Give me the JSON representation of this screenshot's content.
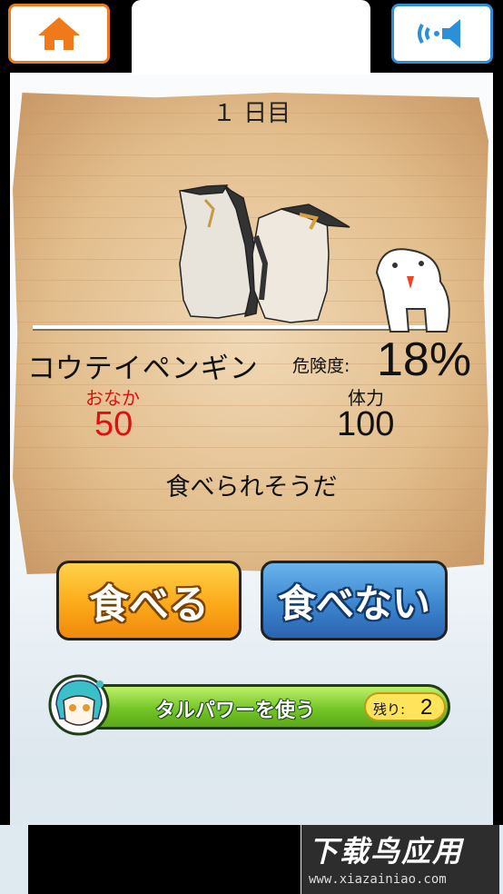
{
  "header": {
    "home_icon": "home-icon",
    "sound_icon": "speaker-icon",
    "accent_home": "#f07a1a",
    "accent_sound": "#2b8fd9"
  },
  "card": {
    "day_label": "１ 日目",
    "species_name": "コウテイペンギン",
    "danger_label": "危険度:",
    "danger_value": "18%",
    "hunger_label": "おなか",
    "hunger_value": "50",
    "stamina_label": "体力",
    "stamina_value": "100",
    "comment": "食べられそうだ"
  },
  "actions": {
    "eat_label": "食べる",
    "no_eat_label": "食べない",
    "eat_color": "#f5a019",
    "no_eat_color": "#3a80cc"
  },
  "power": {
    "label": "タルパワーを使う",
    "remaining_label": "残り:",
    "remaining_value": "2"
  },
  "watermark": {
    "title": "下载鸟应用",
    "url": "www.xiazainiao.com"
  }
}
